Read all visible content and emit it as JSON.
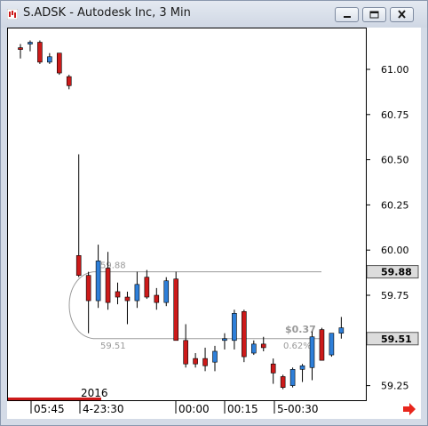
{
  "window": {
    "title": "S.ADSK - Autodesk Inc, 3 Min",
    "buttons": [
      "minimize",
      "restore",
      "close"
    ]
  },
  "colors": {
    "up": "#2e7fd9",
    "down": "#cc1a1a",
    "grid_line": "#9a9a9a",
    "price_box": "#dcdcdc",
    "arrow": "#e8261c"
  },
  "chart_data": {
    "type": "candlestick",
    "symbol": "S.ADSK",
    "interval": "3 Min",
    "y_ticks": [
      "61.00",
      "60.75",
      "60.50",
      "60.25",
      "60.00",
      "59.75",
      "59.50",
      "59.25"
    ],
    "ylim": [
      59.19,
      61.18
    ],
    "x_labels": [
      "05:45",
      "4-23:30",
      "00:00",
      "00:15",
      "5-00:30"
    ],
    "year_label": "2016",
    "price_tags": [
      "59.88",
      "59.51"
    ],
    "levels": [
      {
        "label": "59.88",
        "value": 59.88
      },
      {
        "label": "59.51",
        "value": 59.51
      }
    ],
    "measure": {
      "change": "$0.37",
      "percent": "0.62%"
    },
    "candles": [
      {
        "o": 61.12,
        "h": 61.14,
        "l": 61.06,
        "c": 61.11
      },
      {
        "o": 61.14,
        "h": 61.16,
        "l": 61.1,
        "c": 61.15
      },
      {
        "o": 61.15,
        "h": 61.16,
        "l": 61.03,
        "c": 61.04
      },
      {
        "o": 61.04,
        "h": 61.09,
        "l": 61.03,
        "c": 61.07
      },
      {
        "o": 61.09,
        "h": 61.09,
        "l": 60.97,
        "c": 60.98
      },
      {
        "o": 60.96,
        "h": 60.97,
        "l": 60.89,
        "c": 60.91
      },
      {
        "o": 59.97,
        "h": 60.53,
        "l": 59.85,
        "c": 59.86
      },
      {
        "o": 59.86,
        "h": 59.88,
        "l": 59.54,
        "c": 59.72
      },
      {
        "o": 59.72,
        "h": 60.03,
        "l": 59.68,
        "c": 59.94
      },
      {
        "o": 59.9,
        "h": 59.99,
        "l": 59.67,
        "c": 59.71
      },
      {
        "o": 59.77,
        "h": 59.82,
        "l": 59.7,
        "c": 59.74
      },
      {
        "o": 59.74,
        "h": 59.77,
        "l": 59.59,
        "c": 59.72
      },
      {
        "o": 59.72,
        "h": 59.88,
        "l": 59.68,
        "c": 59.81
      },
      {
        "o": 59.85,
        "h": 59.89,
        "l": 59.73,
        "c": 59.74
      },
      {
        "o": 59.75,
        "h": 59.79,
        "l": 59.67,
        "c": 59.71
      },
      {
        "o": 59.71,
        "h": 59.85,
        "l": 59.69,
        "c": 59.83
      },
      {
        "o": 59.84,
        "h": 59.88,
        "l": 59.53,
        "c": 59.5
      },
      {
        "o": 59.5,
        "h": 59.59,
        "l": 59.35,
        "c": 59.37
      },
      {
        "o": 59.4,
        "h": 59.43,
        "l": 59.35,
        "c": 59.37
      },
      {
        "o": 59.4,
        "h": 59.46,
        "l": 59.33,
        "c": 59.36
      },
      {
        "o": 59.38,
        "h": 59.47,
        "l": 59.33,
        "c": 59.44
      },
      {
        "o": 59.5,
        "h": 59.54,
        "l": 59.45,
        "c": 59.51
      },
      {
        "o": 59.5,
        "h": 59.67,
        "l": 59.45,
        "c": 59.65
      },
      {
        "o": 59.66,
        "h": 59.67,
        "l": 59.38,
        "c": 59.41
      },
      {
        "o": 59.43,
        "h": 59.5,
        "l": 59.42,
        "c": 59.48
      },
      {
        "o": 59.48,
        "h": 59.52,
        "l": 59.44,
        "c": 59.46
      },
      {
        "o": 59.37,
        "h": 59.4,
        "l": 59.26,
        "c": 59.32
      },
      {
        "o": 59.3,
        "h": 59.31,
        "l": 59.23,
        "c": 59.24
      },
      {
        "o": 59.25,
        "h": 59.35,
        "l": 59.24,
        "c": 59.34
      },
      {
        "o": 59.34,
        "h": 59.37,
        "l": 59.27,
        "c": 59.36
      },
      {
        "o": 59.35,
        "h": 59.55,
        "l": 59.28,
        "c": 59.52
      },
      {
        "o": 59.56,
        "h": 59.57,
        "l": 59.39,
        "c": 59.39
      },
      {
        "o": 59.42,
        "h": 59.54,
        "l": 59.41,
        "c": 59.54
      },
      {
        "o": 59.54,
        "h": 59.63,
        "l": 59.51,
        "c": 59.57
      }
    ]
  }
}
